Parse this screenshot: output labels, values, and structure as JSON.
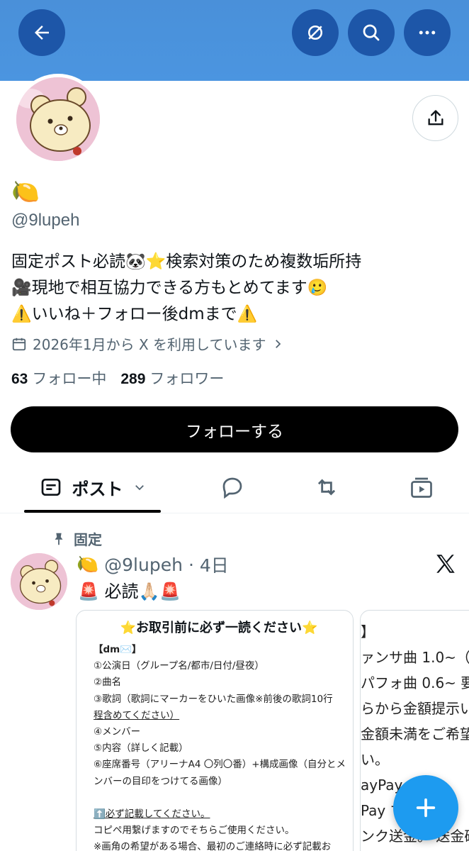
{
  "header": {
    "back_icon": "arrow-left-icon",
    "grok_icon": "grok-icon",
    "search_icon": "search-icon",
    "more_icon": "more-dots-icon"
  },
  "profile": {
    "display_name": "🍋",
    "handle": "@9lupeh",
    "bio_lines": [
      "固定ポスト必読🐼⭐️検索対策のため複数垢所持",
      "🎥現地で相互協力できる方もとめてます🥲",
      "⚠️いいね＋フォロー後dmまで⚠️"
    ],
    "joined": "2026年1月から X を利用しています",
    "following_count": "63",
    "following_label": "フォロー中",
    "followers_count": "289",
    "followers_label": "フォロワー",
    "follow_button": "フォローする"
  },
  "tabs": [
    {
      "label": "ポスト",
      "icon": "post-icon",
      "active": true
    },
    {
      "label": "",
      "icon": "reply-icon"
    },
    {
      "label": "",
      "icon": "repost-icon"
    },
    {
      "label": "",
      "icon": "media-icon"
    }
  ],
  "post": {
    "pinned_label": "固定",
    "author_name": "🍋",
    "handle": "@9lupeh",
    "separator": "·",
    "time": "4日",
    "text": "🚨 必読🙏🏻🚨",
    "card1": {
      "title": "⭐️お取引前に必ず一読ください⭐️",
      "lines": [
        "【dm✉️】",
        "①公演日（グループ名/都市/日付/昼夜）",
        "②曲名",
        "③歌詞（歌詞にマーカーをひいた画像※前後の歌詞10行",
        "程含めてください）",
        "④メンバー",
        "⑤内容（詳しく記載）",
        "⑥座席番号（アリーナA4 〇列〇番）+構成画像（自分とメ",
        "ンバーの目印をつけてる画像）",
        "",
        "⬆️必ず記載してください。",
        "コピペ用繋げますのでそちらご使用ください。",
        "※画角の希望がある場合、最初のご連絡時に必ず記載お"
      ]
    },
    "card2": {
      "lines": [
        "】",
        "ァンサ曲 1.0~（",
        "パフォ曲 0.6~ 要相",
        "らから金額提示い",
        "金額未満をご希望",
        "い。",
        "ayPay",
        "Pay マ",
        "ンク送金。 送金確"
      ]
    }
  },
  "fab": {
    "icon": "plus-icon"
  },
  "colors": {
    "banner": "#4a90d9",
    "accent": "#1d9bf0",
    "follow_bg": "#000000"
  }
}
